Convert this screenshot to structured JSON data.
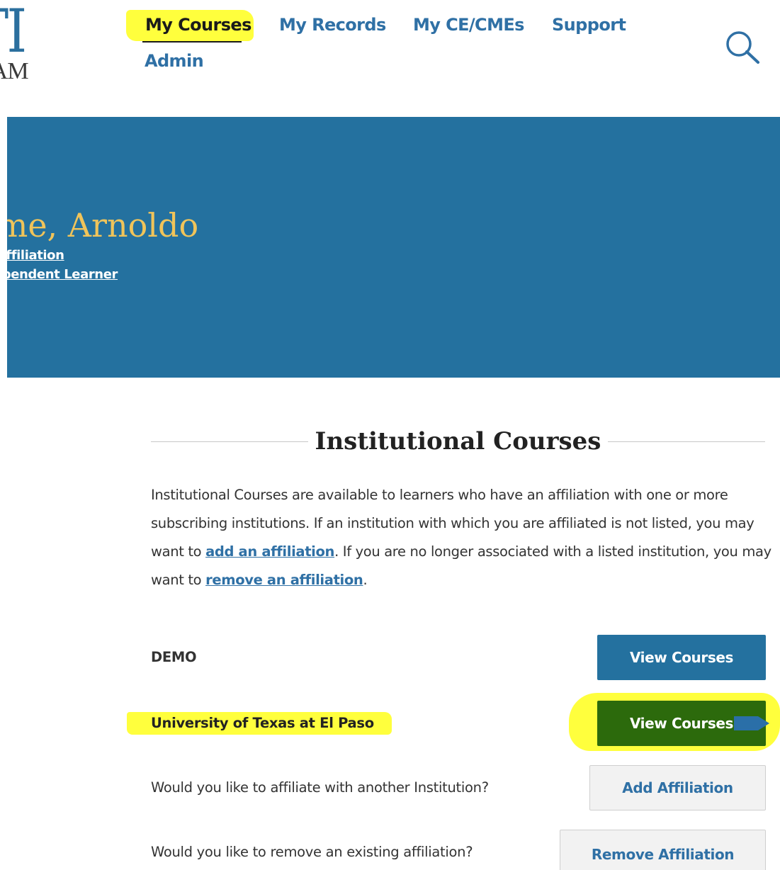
{
  "logo": {
    "top_text": "ITI",
    "bottom_text": "OGRAM"
  },
  "nav": {
    "items": [
      {
        "label": "My Courses",
        "active": true
      },
      {
        "label": "My Records"
      },
      {
        "label": "My CE/CMEs"
      },
      {
        "label": "Support"
      },
      {
        "label": "Admin"
      }
    ],
    "search_icon": "search-icon"
  },
  "banner": {
    "welcome": "ome, Arnoldo",
    "links": [
      "onal Affiliation",
      "ndependent Learner"
    ]
  },
  "institutional": {
    "title": "Institutional Courses",
    "intro_part1": "Institutional Courses are available to learners who have an affiliation with one or more subscribing institutions. If an institution with which you are affiliated is not listed, you may want to ",
    "add_link": "add an affiliation",
    "intro_part2": ". If you are no longer associated with a listed institution, you may want to ",
    "remove_link": "remove an affiliation",
    "intro_part3": ".",
    "rows": [
      {
        "label": "DEMO",
        "button": "View Courses"
      },
      {
        "label": "University of Texas at El Paso",
        "button": "View Courses",
        "highlighted": true
      }
    ],
    "add_affiliation": {
      "question": "Would you like to affiliate with another Institution?",
      "button": "Add Affiliation"
    },
    "remove_affiliation": {
      "question": "Would you like to remove an existing affiliation?",
      "button": "Remove Affiliation"
    }
  },
  "colors": {
    "brand_blue": "#24719f",
    "link_blue": "#2f70a5",
    "welcome_gold": "#f0c45a",
    "highlight_yellow": "#ffff3d",
    "highlighted_button_green": "#2c6a0c"
  }
}
